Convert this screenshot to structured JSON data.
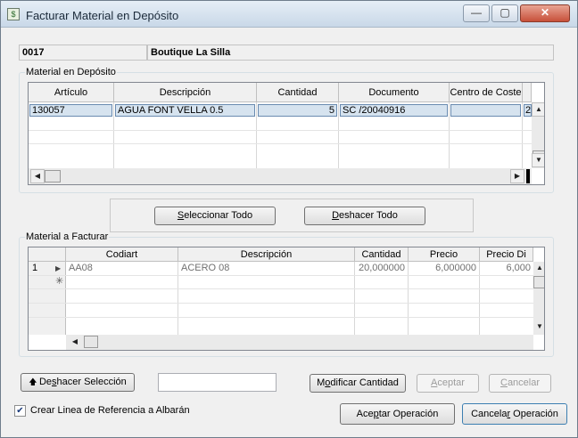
{
  "window": {
    "title": "Facturar Material en Depósito",
    "controls": {
      "minimize": "—",
      "maximize": "▢",
      "close": "✕"
    }
  },
  "header": {
    "code": "0017",
    "name": "Boutique La Silla"
  },
  "deposito": {
    "label": "Material en Depósito",
    "columns": [
      "Artículo",
      "Descripción",
      "Cantidad",
      "Documento",
      "Centro de Coste"
    ],
    "rows": [
      {
        "articulo": "130057",
        "descripcion": "AGUA FONT VELLA 0.5",
        "cantidad": "5",
        "documento": "SC /20040916",
        "extra": "2"
      }
    ]
  },
  "buttons_mid": {
    "select_all": {
      "pre": "",
      "u": "S",
      "post": "eleccionar Todo"
    },
    "undo_all": {
      "pre": "",
      "u": "D",
      "post": "eshacer Todo"
    }
  },
  "facturar": {
    "label": "Material a Facturar",
    "columns": [
      "Codiart",
      "Descripción",
      "Cantidad",
      "Precio",
      "Precio Di"
    ],
    "rows": [
      {
        "num": "1",
        "codiart": "AA08",
        "descripcion": "ACERO 08",
        "cantidad": "20,000000",
        "precio": "6,000000",
        "precio_di": "6,000"
      }
    ],
    "new_row_marker": "✳"
  },
  "bottom": {
    "undo_selection": {
      "pre": "De",
      "u": "s",
      "post": "hacer Selección"
    },
    "modify_qty": {
      "pre": "M",
      "u": "o",
      "post": "dificar Cantidad"
    },
    "accept": {
      "pre": "",
      "u": "A",
      "post": "ceptar"
    },
    "cancel": {
      "pre": "",
      "u": "C",
      "post": "ancelar"
    },
    "checkbox_label": "Crear Linea de Referencia a Albarán",
    "checkbox_checked": true,
    "accept_op": {
      "pre": "Ace",
      "u": "p",
      "post": "tar Operación"
    },
    "cancel_op": {
      "pre": "Cancela",
      "u": "r",
      "post": " Operación"
    }
  }
}
